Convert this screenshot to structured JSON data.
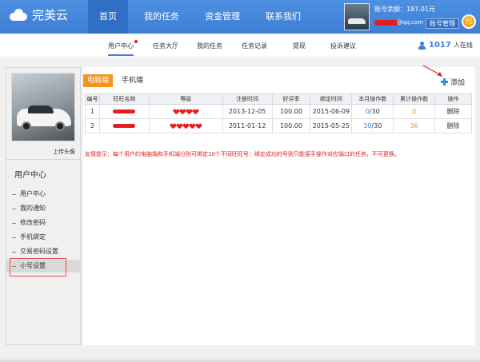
{
  "header": {
    "logo_text": "完美云",
    "nav": [
      {
        "label": "首页",
        "active": true
      },
      {
        "label": "我的任务",
        "active": false
      },
      {
        "label": "资金管理",
        "active": false
      },
      {
        "label": "联系我们",
        "active": false
      }
    ],
    "balance_text": "账号余额：187.01元",
    "account_suffix": "@qq.com",
    "account_manage_label": "账号管理",
    "vip_badge": "元"
  },
  "subnav": {
    "tabs": [
      {
        "label": "用户中心",
        "active": true
      },
      {
        "label": "任务大厅",
        "active": false
      },
      {
        "label": "我的任务",
        "active": false
      },
      {
        "label": "任务记录",
        "active": false
      },
      {
        "label": "提现",
        "active": false
      },
      {
        "label": "投诉建议",
        "active": false
      }
    ],
    "online_count": "1017",
    "online_label": "人在线"
  },
  "sidebar": {
    "upload_label": "上传头像",
    "heading": "用户中心",
    "items": [
      {
        "label": "用户中心",
        "active": false
      },
      {
        "label": "我的通知",
        "active": false
      },
      {
        "label": "修改密码",
        "active": false
      },
      {
        "label": "手机绑定",
        "active": false
      },
      {
        "label": "交易密码设置",
        "active": false
      },
      {
        "label": "小号设置",
        "active": true
      }
    ]
  },
  "main": {
    "channel_tabs": [
      {
        "label": "电脑端",
        "active": true
      },
      {
        "label": "手机端",
        "active": false
      }
    ],
    "add_label": "添加",
    "table": {
      "headers": [
        "编号",
        "旺旺名称",
        "等级",
        "注册时间",
        "好评率",
        "绑定时间",
        "本月操作数",
        "累计操作数",
        "操作"
      ],
      "rows": [
        {
          "no": "1",
          "level_hearts": 4,
          "reg_date": "2013-12-05",
          "rate": "100.00",
          "bind_date": "2015-06-09",
          "month_done": "0",
          "month_total": "/30",
          "total": "0",
          "action": "删除"
        },
        {
          "no": "2",
          "level_hearts": 5,
          "reg_date": "2011-01-12",
          "rate": "100.00",
          "bind_date": "2015-05-25",
          "month_done": "30",
          "month_total": "/30",
          "total": "36",
          "action": "删除"
        }
      ]
    },
    "notice": "友情提示：每个用户的电脑端和手机端分别可绑定10个不同旺旺号：绑定成功的号则只能接手操作对应端口的任务，不可更换。"
  },
  "colors": {
    "header_blue": "#4d8fe0",
    "accent_orange": "#f3941b",
    "link_blue": "#3e88d8",
    "alert_red": "#e02020"
  }
}
